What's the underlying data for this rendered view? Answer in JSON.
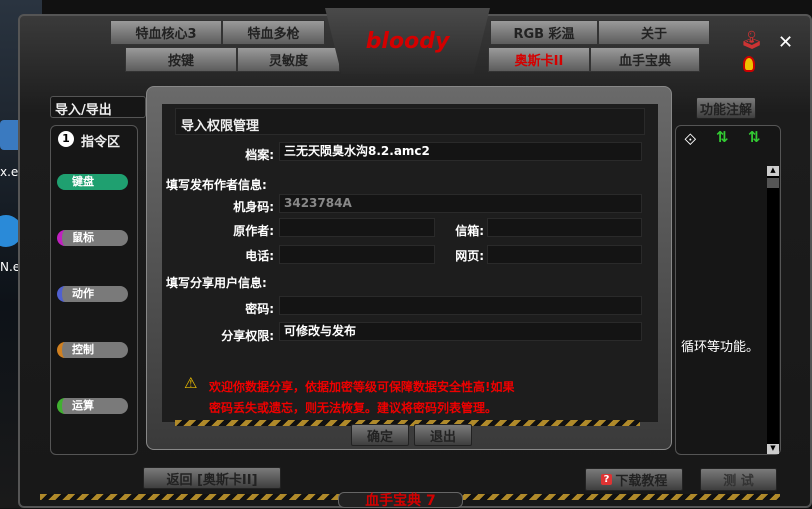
{
  "desktop": {
    "icon_labels": [
      "x.exe",
      "N.exe"
    ]
  },
  "top_tabs": {
    "row1": [
      "特血核心3",
      "特血多枪",
      "RGB 彩温",
      "关于"
    ],
    "row2": [
      "按键",
      "灵敏度",
      "奥斯卡II",
      "血手宝典"
    ],
    "active": "奥斯卡II",
    "logo": "bloody"
  },
  "left": {
    "header": "导入/导出",
    "section_number": "1",
    "section_title": "指令区",
    "commands": [
      {
        "label": "键盘",
        "color": "#1fa070"
      },
      {
        "label": "鼠标",
        "color": "#c020c0"
      },
      {
        "label": "动作",
        "color": "#5060d0"
      },
      {
        "label": "控制",
        "color": "#d08020"
      },
      {
        "label": "运算",
        "color": "#40b030"
      }
    ]
  },
  "dialog": {
    "title": "导入权限管理",
    "file_label": "档案:",
    "file_value": "三无天陨臭水沟8.2.amc2",
    "author_section": "填写发布作者信息:",
    "machine_label": "机身码:",
    "machine_value": "3423784A",
    "author_label": "原作者:",
    "author_value": "",
    "email_label": "信箱:",
    "email_value": "",
    "phone_label": "电话:",
    "phone_value": "",
    "web_label": "网页:",
    "web_value": "",
    "share_section": "填写分享用户信息:",
    "password_label": "密码:",
    "password_value": "",
    "permission_label": "分享权限:",
    "permission_value": "可修改与发布",
    "warning_line1": "欢迎你数据分享，依据加密等级可保障数据安全性高!如果",
    "warning_line2": "密码丢失或遗忘，则无法恢复。建议将密码列表管理。",
    "ok": "确定",
    "exit": "退出"
  },
  "right": {
    "notes_button": "功能注解",
    "text": "循环等功能。"
  },
  "bottom": {
    "back": "返回 [奥斯卡II]",
    "download": "下载教程",
    "test": "测 试",
    "banner": "血手宝典 7"
  },
  "colors": {
    "accent": "#d40000",
    "warning": "#e00000"
  }
}
